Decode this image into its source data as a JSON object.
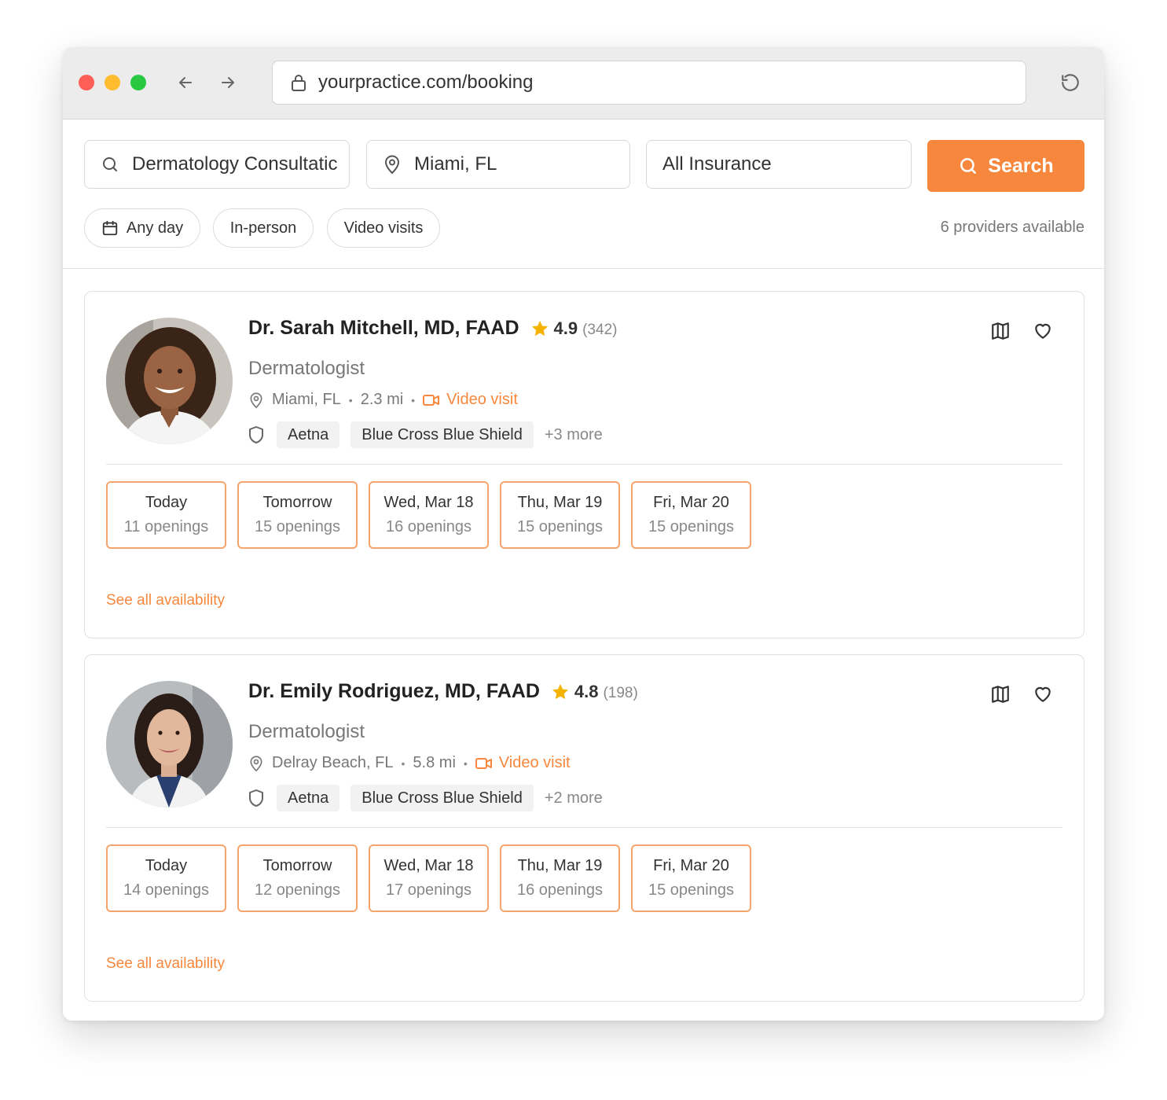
{
  "browser": {
    "url": "yourpractice.com/booking"
  },
  "search": {
    "specialty_value": "Dermatology Consultatic",
    "location_value": "Miami, FL",
    "insurance_value": "All Insurance",
    "search_label": "Search"
  },
  "filters": {
    "any_day": "Any day",
    "in_person": "In-person",
    "video_visits": "Video visits"
  },
  "providers_count": "6 providers available",
  "accent_color": "#f7873c",
  "providers": [
    {
      "name": "Dr. Sarah Mitchell, MD, FAAD",
      "rating": "4.9",
      "reviews": "(342)",
      "specialty": "Dermatologist",
      "location": "Miami, FL",
      "distance": "2.3 mi",
      "video_label": "Video visit",
      "insurance": [
        "Aetna",
        "Blue Cross Blue Shield"
      ],
      "insurance_more": "+3 more",
      "slots": [
        {
          "day": "Today",
          "openings": "11 openings"
        },
        {
          "day": "Tomorrow",
          "openings": "15 openings"
        },
        {
          "day": "Wed, Mar 18",
          "openings": "16 openings"
        },
        {
          "day": "Thu, Mar 19",
          "openings": "15 openings"
        },
        {
          "day": "Fri, Mar 20",
          "openings": "15 openings"
        }
      ],
      "see_all": "See all availability"
    },
    {
      "name": "Dr. Emily Rodriguez, MD, FAAD",
      "rating": "4.8",
      "reviews": "(198)",
      "specialty": "Dermatologist",
      "location": "Delray Beach, FL",
      "distance": "5.8 mi",
      "video_label": "Video visit",
      "insurance": [
        "Aetna",
        "Blue Cross Blue Shield"
      ],
      "insurance_more": "+2 more",
      "slots": [
        {
          "day": "Today",
          "openings": "14 openings"
        },
        {
          "day": "Tomorrow",
          "openings": "12 openings"
        },
        {
          "day": "Wed, Mar 18",
          "openings": "17 openings"
        },
        {
          "day": "Thu, Mar 19",
          "openings": "16 openings"
        },
        {
          "day": "Fri, Mar 20",
          "openings": "15 openings"
        }
      ],
      "see_all": "See all availability"
    }
  ]
}
